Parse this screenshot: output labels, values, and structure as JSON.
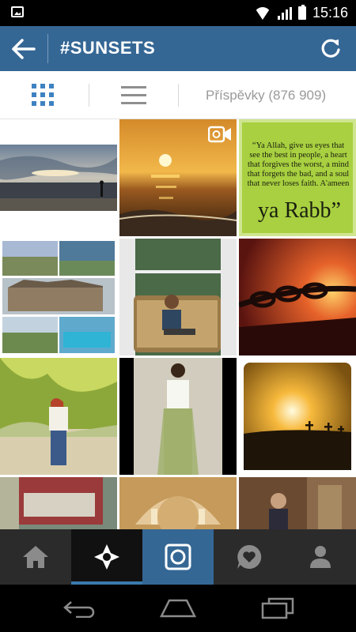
{
  "status_bar": {
    "time": "15:16"
  },
  "header": {
    "title": "#SUNSETS"
  },
  "switcher": {
    "posts_label": "Příspěvky (876 909)"
  },
  "grid": {
    "tiles": [
      {
        "name": "photo-beach-sunset-person"
      },
      {
        "name": "photo-sea-sunset-video"
      },
      {
        "name": "photo-quote",
        "quote_text": "“Ya Allah, give us eyes that see the best in people, a heart that forgives the worst, a mind that forgets the bad, and a soul that never loses faith. A'ameen",
        "quote_signature": "ya Rabb”"
      },
      {
        "name": "photo-hotel-collage"
      },
      {
        "name": "photo-man-on-couch"
      },
      {
        "name": "photo-chain-sunset"
      },
      {
        "name": "photo-girl-tree"
      },
      {
        "name": "photo-girl-white-top"
      },
      {
        "name": "photo-graveyard-sunset"
      },
      {
        "name": "photo-building-street"
      },
      {
        "name": "photo-church-dome"
      },
      {
        "name": "photo-girl-doorway"
      }
    ]
  },
  "tabbar": {
    "items": [
      {
        "icon": "home-icon"
      },
      {
        "icon": "explore-icon",
        "active": true
      },
      {
        "icon": "camera-icon"
      },
      {
        "icon": "activity-heart-icon"
      },
      {
        "icon": "profile-icon"
      }
    ]
  },
  "colors": {
    "header": "#356795",
    "accent": "#3e82c1",
    "tabbar": "#2b2b2b"
  }
}
